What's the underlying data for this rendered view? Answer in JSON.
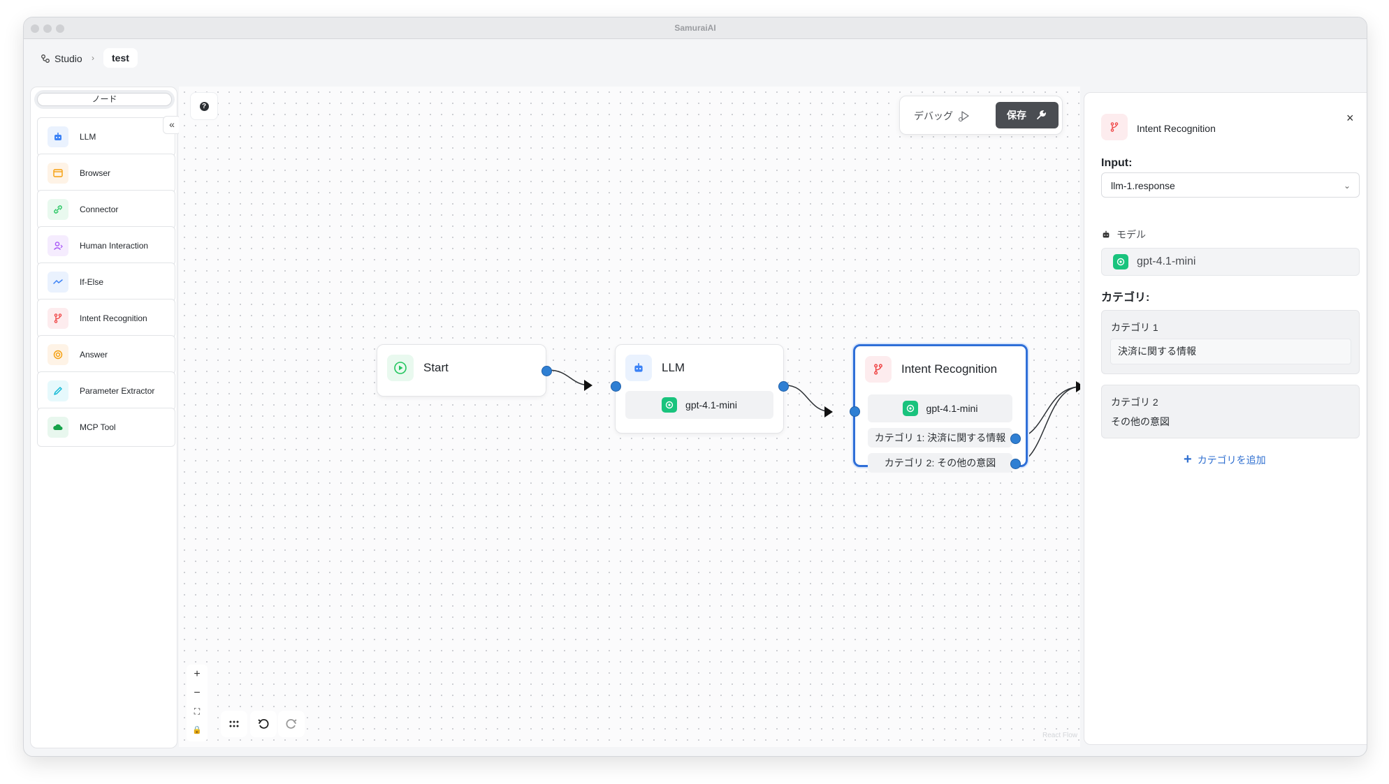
{
  "window": {
    "title": "SamuraiAI"
  },
  "breadcrumb": {
    "studio": "Studio",
    "separator": "›",
    "current": "test"
  },
  "sidebar": {
    "search_placeholder": "ノード",
    "collapse_label": "«",
    "items": [
      {
        "label": "LLM",
        "icon": "robot-icon",
        "color": "#3b82f6"
      },
      {
        "label": "Browser",
        "icon": "browser-icon",
        "color": "#f59e0b"
      },
      {
        "label": "Connector",
        "icon": "link-icon",
        "color": "#22c55e"
      },
      {
        "label": "Human Interaction",
        "icon": "user-icon",
        "color": "#a855f7"
      },
      {
        "label": "If-Else",
        "icon": "branch-icon",
        "color": "#3b82f6"
      },
      {
        "label": "Intent Recognition",
        "icon": "fork-icon",
        "color": "#ef4444"
      },
      {
        "label": "Answer",
        "icon": "target-icon",
        "color": "#f59e0b"
      },
      {
        "label": "Parameter Extractor",
        "icon": "pencil-icon",
        "color": "#06b6d4"
      },
      {
        "label": "MCP Tool",
        "icon": "cloud-icon",
        "color": "#16a34a"
      }
    ]
  },
  "canvas": {
    "help": "?",
    "toolbar": {
      "debug_label": "デバッグ",
      "save_label": "保存"
    },
    "nodes": {
      "start": {
        "title": "Start"
      },
      "llm": {
        "title": "LLM",
        "model": "gpt-4.1-mini"
      },
      "intent": {
        "title": "Intent Recognition",
        "model": "gpt-4.1-mini",
        "categories": [
          "カテゴリ 1: 決済に関する情報",
          "カテゴリ 2: その他の意図"
        ]
      }
    },
    "controls": {
      "zoom_in": "+",
      "zoom_out": "−",
      "fit": "⛶",
      "lock": "🔒"
    },
    "watermark": "React Flow"
  },
  "panel": {
    "title": "Intent Recognition",
    "close": "×",
    "input_label": "Input:",
    "input_value": "llm-1.response",
    "model_label": "モデル",
    "model_value": "gpt-4.1-mini",
    "categories_label": "カテゴリ:",
    "categories": [
      {
        "title": "カテゴリ 1",
        "value": "決済に関する情報"
      },
      {
        "title": "カテゴリ 2",
        "value": "その他の意図"
      }
    ],
    "add_category": "カテゴリを追加"
  },
  "colors": {
    "accent": "#2f7fd3",
    "save_button": "#4a4d52",
    "gpt_green": "#19c37d",
    "selected_border": "#2f6fd8"
  }
}
